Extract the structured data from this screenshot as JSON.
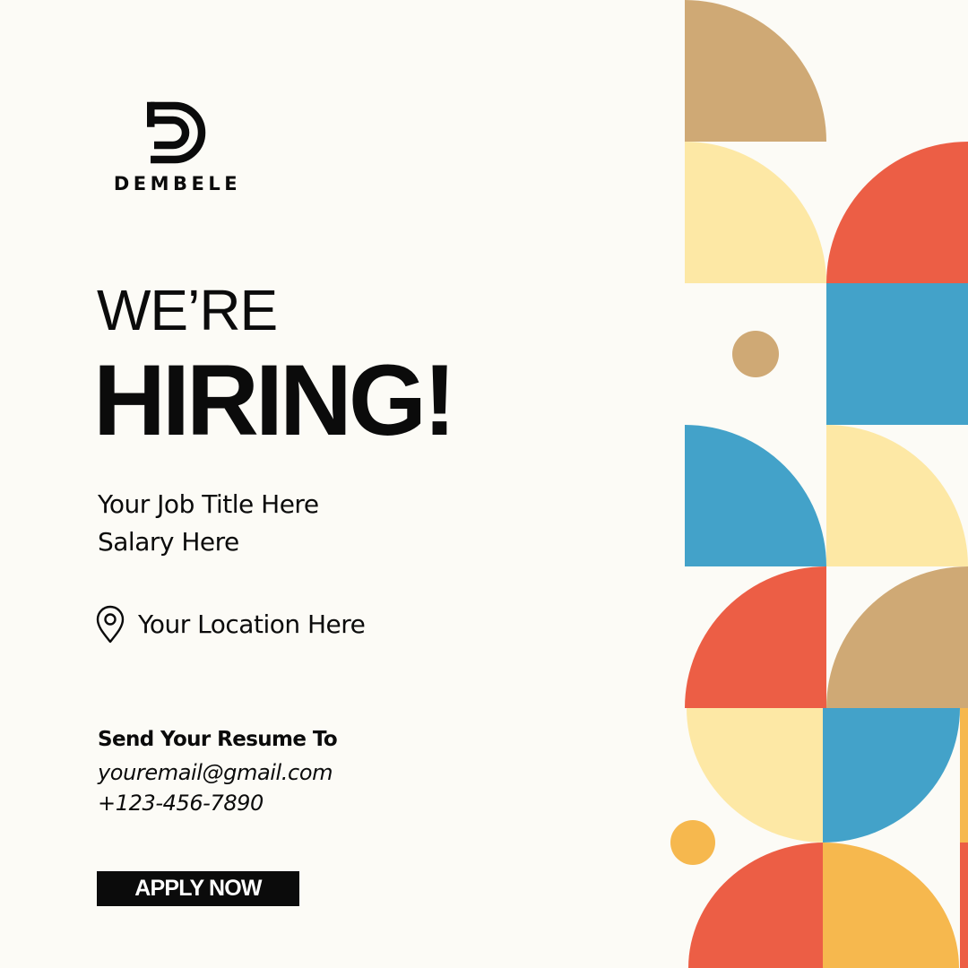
{
  "brand": {
    "name": "DEMBELE",
    "logo_icon": "d-monogram-icon"
  },
  "headline": {
    "line1": "WE’RE",
    "line2": "HIRING!"
  },
  "job": {
    "title": "Your Job Title Here",
    "salary": "Salary Here",
    "location": "Your Location Here",
    "location_icon": "location-pin-icon"
  },
  "contact": {
    "label": "Send Your Resume To",
    "email": "youremail@gmail.com",
    "phone": "+123-456-7890"
  },
  "cta": {
    "label": "APPLY NOW"
  },
  "colors": {
    "background": "#fcfbf6",
    "text": "#0b0b0b",
    "tan": "#cfa975",
    "cream": "#fde8a5",
    "coral": "#ec5e45",
    "blue": "#43a2c9",
    "orange": "#f6b84e"
  }
}
